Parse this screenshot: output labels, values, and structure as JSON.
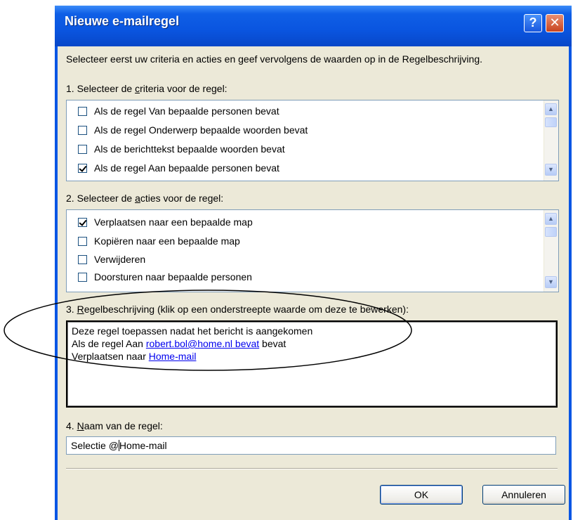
{
  "window": {
    "title": "Nieuwe e-mailregel",
    "help_glyph": "?",
    "close_glyph": "✕"
  },
  "intro_text": "Selecteer eerst uw criteria en acties en geef vervolgens de waarden op in de Regelbeschrijving.",
  "criteria": {
    "label_pre": "1. Selecteer de ",
    "label_u": "c",
    "label_post": "riteria voor de regel:",
    "items": [
      {
        "label": "Als de regel Van bepaalde personen bevat",
        "checked": false
      },
      {
        "label": "Als de regel Onderwerp bepaalde woorden bevat",
        "checked": false
      },
      {
        "label": "Als de berichttekst bepaalde woorden bevat",
        "checked": false
      },
      {
        "label": "Als de regel Aan bepaalde personen bevat",
        "checked": true
      }
    ]
  },
  "actions": {
    "label_pre": "2. Selecteer de ",
    "label_u": "a",
    "label_post": "cties voor de regel:",
    "items": [
      {
        "label": "Verplaatsen naar een bepaalde map",
        "checked": true
      },
      {
        "label": "Kopiëren naar een bepaalde map",
        "checked": false
      },
      {
        "label": "Verwijderen",
        "checked": false
      },
      {
        "label": "Doorsturen naar bepaalde personen",
        "checked": false
      }
    ]
  },
  "description": {
    "label_pre": "3. ",
    "label_u": "R",
    "label_post": "egelbeschrijving (klik op een onderstreepte waarde om deze te bewerken):",
    "line1": "Deze regel toepassen nadat het bericht is aangekomen",
    "line2_pre": "Als de regel Aan ",
    "line2_link": "robert.bol@home.nl bevat",
    "line2_post": " bevat",
    "line3_pre": "Verplaatsen naar ",
    "line3_link": "Home-mail"
  },
  "rule_name": {
    "label_pre": "4. ",
    "label_u": "N",
    "label_post": "aam van de regel:",
    "value_pre": "Selectie @",
    "value_post": "Home-mail"
  },
  "buttons": {
    "ok": "OK",
    "cancel": "Annuleren"
  },
  "scroll_icons": {
    "up": "▲",
    "down": "▼"
  }
}
